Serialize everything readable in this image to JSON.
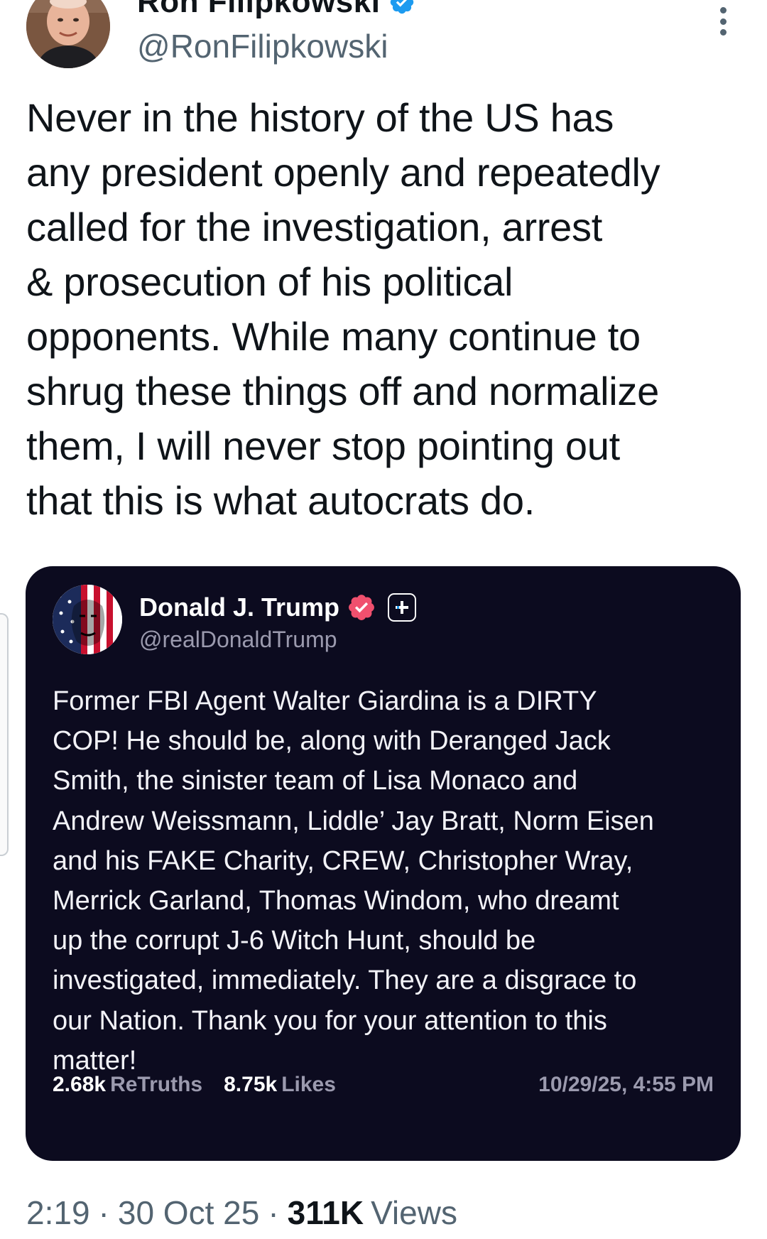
{
  "author": {
    "display_name": "Ron Filipkowski",
    "handle": "@RonFilipkowski",
    "verified_icon": "verified-badge-icon",
    "menu_icon": "more-vertical-icon"
  },
  "tweet": {
    "text": "Never in the history of the US has\nany president openly and repeatedly\ncalled for the investigation, arrest\n& prosecution of his political\nopponents. While many continue to\nshrug these things off and normalize\nthem, I will never stop pointing out\nthat this is what autocrats do."
  },
  "quoted_post": {
    "display_name": "Donald J. Trump",
    "handle": "@realDonaldTrump",
    "verified_icon": "verified-badge-icon",
    "plus_icon": "plus-icon",
    "text": "Former FBI Agent Walter Giardina is a DIRTY\nCOP! He should be, along with Deranged Jack\nSmith, the sinister team of Lisa Monaco and\nAndrew Weissmann, Liddle’ Jay Bratt, Norm Eisen\nand his FAKE Charity, CREW, Christopher Wray,\nMerrick Garland, Thomas Windom, who dreamt\nup the corrupt J-6 Witch Hunt, should be\ninvestigated, immediately. They are a disgrace to\nour Nation. Thank you for your attention to this\nmatter!",
    "retruths_count": "2.68k",
    "retruths_label": "ReTruths",
    "likes_count": "8.75k",
    "likes_label": "Likes",
    "timestamp": "10/29/25, 4:55 PM"
  },
  "meta": {
    "time": "2:19",
    "separator": "·",
    "date": "30 Oct 25",
    "views_count": "311K",
    "views_label": "Views"
  },
  "colors": {
    "twitter_blue": "#1d9bf0",
    "truth_card_bg": "#0c0b1f",
    "truth_verified": "#f0506e",
    "muted_text": "#536471"
  }
}
